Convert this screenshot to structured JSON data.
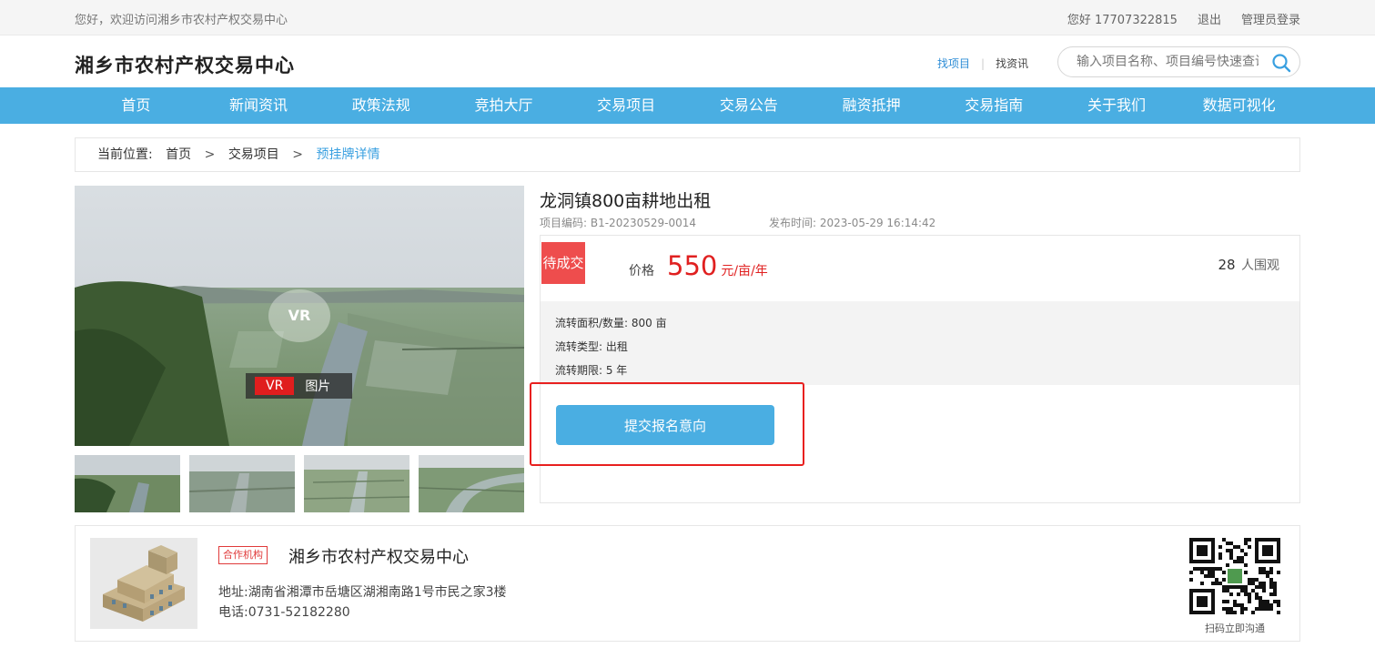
{
  "topbar": {
    "welcome": "您好，欢迎访问湘乡市农村产权交易中心",
    "user": "您好 17707322815",
    "logout": "退出",
    "admin_login": "管理员登录"
  },
  "header": {
    "site_title": "湘乡市农村产权交易中心",
    "link_find_project": "找项目",
    "link_find_news": "找资讯",
    "search_placeholder": "输入项目名称、项目编号快速查询"
  },
  "nav": {
    "items": [
      "首页",
      "新闻资讯",
      "政策法规",
      "竞拍大厅",
      "交易项目",
      "交易公告",
      "融资抵押",
      "交易指南",
      "关于我们",
      "数据可视化"
    ]
  },
  "breadcrumb": {
    "label": "当前位置:",
    "home": "首页",
    "level1": "交易项目",
    "current": "预挂牌详情",
    "separator": ">"
  },
  "gallery": {
    "vr_badge": "VR",
    "tab_vr": "VR",
    "tab_picture": "图片"
  },
  "project": {
    "title": "龙洞镇800亩耕地出租",
    "code": "项目编码: B1-20230529-0014",
    "publish_time": "发布时间: 2023-05-29 16:14:42",
    "status": "待成交",
    "price_label": "价格",
    "price_value": "550",
    "price_unit": "元/亩/年",
    "viewers_count": "28",
    "viewers_label": "人围观",
    "details": [
      "流转面积/数量: 800 亩",
      "流转类型: 出租",
      "流转期限: 5 年"
    ],
    "submit_label": "提交报名意向"
  },
  "organization": {
    "tag": "合作机构",
    "name": "湘乡市农村产权交易中心",
    "address": "地址:湖南省湘潭市岳塘区湖湘南路1号市民之家3楼",
    "phone": "电话:0731-52182280",
    "qr_caption": "扫码立即沟通"
  },
  "colors": {
    "nav_blue": "#4aaee2",
    "price_red": "#e02020",
    "status_red": "#ee4d4d",
    "highlight_red": "#e8201f"
  }
}
